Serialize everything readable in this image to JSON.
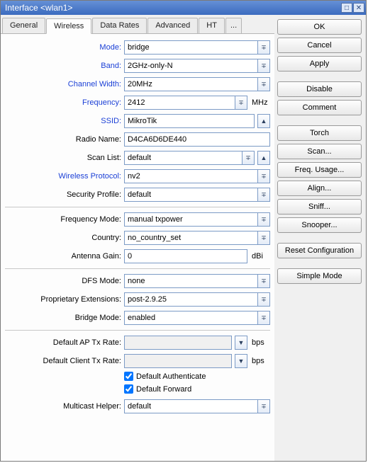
{
  "window": {
    "title": "Interface <wlan1>"
  },
  "tabs": {
    "general": "General",
    "wireless": "Wireless",
    "data_rates": "Data Rates",
    "advanced": "Advanced",
    "ht": "HT",
    "more": "..."
  },
  "labels": {
    "mode": "Mode:",
    "band": "Band:",
    "channel_width": "Channel Width:",
    "frequency": "Frequency:",
    "ssid": "SSID:",
    "radio_name": "Radio Name:",
    "scan_list": "Scan List:",
    "wireless_protocol": "Wireless Protocol:",
    "security_profile": "Security Profile:",
    "frequency_mode": "Frequency Mode:",
    "country": "Country:",
    "antenna_gain": "Antenna Gain:",
    "dfs_mode": "DFS Mode:",
    "proprietary_ext": "Proprietary Extensions:",
    "bridge_mode": "Bridge Mode:",
    "default_ap_tx": "Default AP Tx Rate:",
    "default_client_tx": "Default Client Tx Rate:",
    "default_auth": "Default Authenticate",
    "default_forward": "Default Forward",
    "multicast_helper": "Multicast Helper:"
  },
  "units": {
    "mhz": "MHz",
    "dbi": "dBi",
    "bps": "bps"
  },
  "values": {
    "mode": "bridge",
    "band": "2GHz-only-N",
    "channel_width": "20MHz",
    "frequency": "2412",
    "ssid": "MikroTik",
    "radio_name": "D4CA6D6DE440",
    "scan_list": "default",
    "wireless_protocol": "nv2",
    "security_profile": "default",
    "frequency_mode": "manual txpower",
    "country": "no_country_set",
    "antenna_gain": "0",
    "dfs_mode": "none",
    "proprietary_ext": "post-2.9.25",
    "bridge_mode": "enabled",
    "default_ap_tx": "",
    "default_client_tx": "",
    "multicast_helper": "default"
  },
  "checkboxes": {
    "default_auth": true,
    "default_forward": true
  },
  "buttons": {
    "ok": "OK",
    "cancel": "Cancel",
    "apply": "Apply",
    "disable": "Disable",
    "comment": "Comment",
    "torch": "Torch",
    "scan": "Scan...",
    "freq_usage": "Freq. Usage...",
    "align": "Align...",
    "sniff": "Sniff...",
    "snooper": "Snooper...",
    "reset_cfg": "Reset Configuration",
    "simple_mode": "Simple Mode"
  }
}
